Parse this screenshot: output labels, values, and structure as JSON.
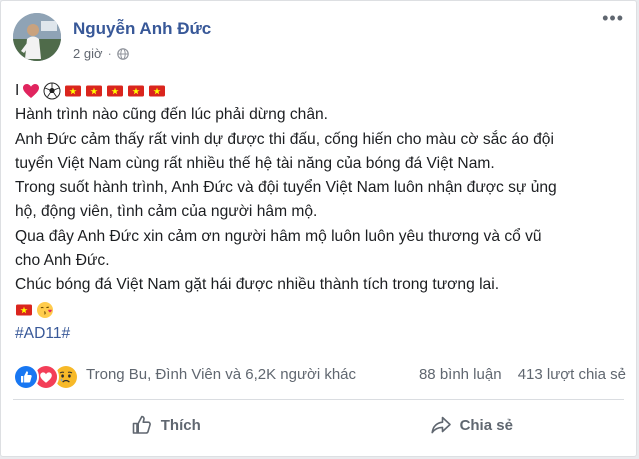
{
  "post": {
    "author": "Nguyễn Anh Đức",
    "time": "2 giờ",
    "privacy_icon": "globe-icon",
    "lines": [
      "Hành trình nào cũng đến lúc phải dừng chân.",
      "Anh Đức cảm thấy rất vinh dự được thi đấu, cống hiến cho màu cờ sắc áo đội",
      "tuyển Việt Nam cùng rất nhiều thế hệ tài năng của bóng đá Việt Nam.",
      "Trong suốt hành trình, Anh Đức và đội tuyển Việt Nam luôn nhận được sự ủng",
      "hộ, động viên, tình cảm của người hâm mộ.",
      "Qua đây Anh Đức xin cảm ơn người hâm mộ luôn luôn yêu thương và cổ vũ",
      "cho Anh Đức.",
      "Chúc bóng đá Việt Nam gặt hái được nhiều thành tích trong tương lai."
    ],
    "first_line_prefix": "I",
    "first_line_emojis": [
      "heart-emoji",
      "soccer-ball-emoji",
      "vietnam-flag-emoji",
      "vietnam-flag-emoji",
      "vietnam-flag-emoji",
      "vietnam-flag-emoji",
      "vietnam-flag-emoji"
    ],
    "closing_emojis": [
      "vietnam-flag-emoji",
      "face-blowing-kiss-emoji"
    ],
    "hashtag": "#AD11#"
  },
  "reactions": {
    "types": [
      "like-reaction",
      "love-reaction",
      "sad-reaction"
    ],
    "names": "Trong Bu, Đình Viên và 6,2K người khác",
    "comments": "88 bình luận",
    "shares": "413 lượt chia sẻ"
  },
  "actions": {
    "like_label": "Thích",
    "share_label": "Chia sẻ"
  },
  "colors": {
    "author": "#385898",
    "text": "#1c1e21",
    "muted": "#606770",
    "like_blue": "#1877f2",
    "love_red": "#f33e58",
    "sad_yellow": "#f7b928",
    "flag_red": "#da251d",
    "flag_star": "#ffff00"
  }
}
